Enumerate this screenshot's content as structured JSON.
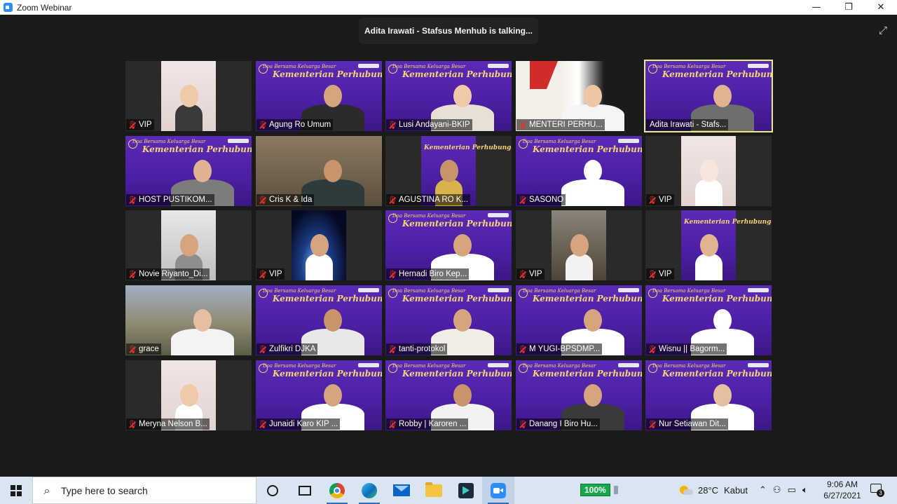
{
  "window": {
    "title": "Zoom Webinar",
    "controls": {
      "minimize": "—",
      "restore": "❐",
      "close": "✕"
    }
  },
  "meeting": {
    "talking_indicator": "Adita Irawati - Stafsus Menhub is talking...",
    "fullscreen_icon": "⤢",
    "colors": {
      "active_speaker_border": "#e8ef7c",
      "muted_mic": "#e0332d",
      "background": "#1a1a1a"
    },
    "banner": {
      "line1": "Doa Bersama Keluarga Besar",
      "line2": "Kementerian Perhubungan"
    },
    "participants": [
      {
        "name": "VIP",
        "muted": true
      },
      {
        "name": "Agung Ro Umum",
        "muted": true
      },
      {
        "name": "Lusi Andayani-BKIP",
        "muted": true
      },
      {
        "name": "MENTERI PERHU...",
        "muted": true
      },
      {
        "name": "Adita Irawati - Stafs...",
        "muted": false,
        "active_speaker": true
      },
      {
        "name": "HOST PUSTIKOM...",
        "muted": true
      },
      {
        "name": "Cris K & Ida",
        "muted": true
      },
      {
        "name": "AGUSTINA RO K...",
        "muted": true
      },
      {
        "name": "SASONO",
        "muted": true
      },
      {
        "name": "VIP",
        "muted": true
      },
      {
        "name": "Novie Riyanto_Di...",
        "muted": true
      },
      {
        "name": "VIP",
        "muted": true
      },
      {
        "name": "Hernadi Biro Kep...",
        "muted": true
      },
      {
        "name": "VIP",
        "muted": true
      },
      {
        "name": "VIP",
        "muted": true
      },
      {
        "name": "grace",
        "muted": true
      },
      {
        "name": "Zulfikri DJKA",
        "muted": true
      },
      {
        "name": "tanti-protokol",
        "muted": true
      },
      {
        "name": "M YUGI-BPSDMP...",
        "muted": true
      },
      {
        "name": "Wisnu || Bagorm...",
        "muted": true
      },
      {
        "name": "Meryna Nelson B...",
        "muted": true
      },
      {
        "name": "Junaidi Karo KIP ...",
        "muted": true
      },
      {
        "name": "Robby | Karoren ...",
        "muted": true
      },
      {
        "name": "Danang I Biro Hu...",
        "muted": true
      },
      {
        "name": "Nur Setiawan Dit...",
        "muted": true
      }
    ]
  },
  "taskbar": {
    "search_placeholder": "Type here to search",
    "search_icon": "⌕",
    "apps": [
      "cortana-icon",
      "task-view-icon",
      "chrome-icon",
      "edge-icon",
      "mail-icon",
      "file-explorer-icon",
      "app-icon",
      "zoom-icon"
    ],
    "battery_percent": "100%",
    "weather": {
      "temp": "28°C",
      "condition": "Kabut"
    },
    "tray_icons": {
      "chevron": "⌃",
      "people": "⚇",
      "network": "▭",
      "volume": "🔈︎"
    },
    "clock": {
      "time": "9:06 AM",
      "date": "6/27/2021"
    },
    "notification_count": "3"
  }
}
